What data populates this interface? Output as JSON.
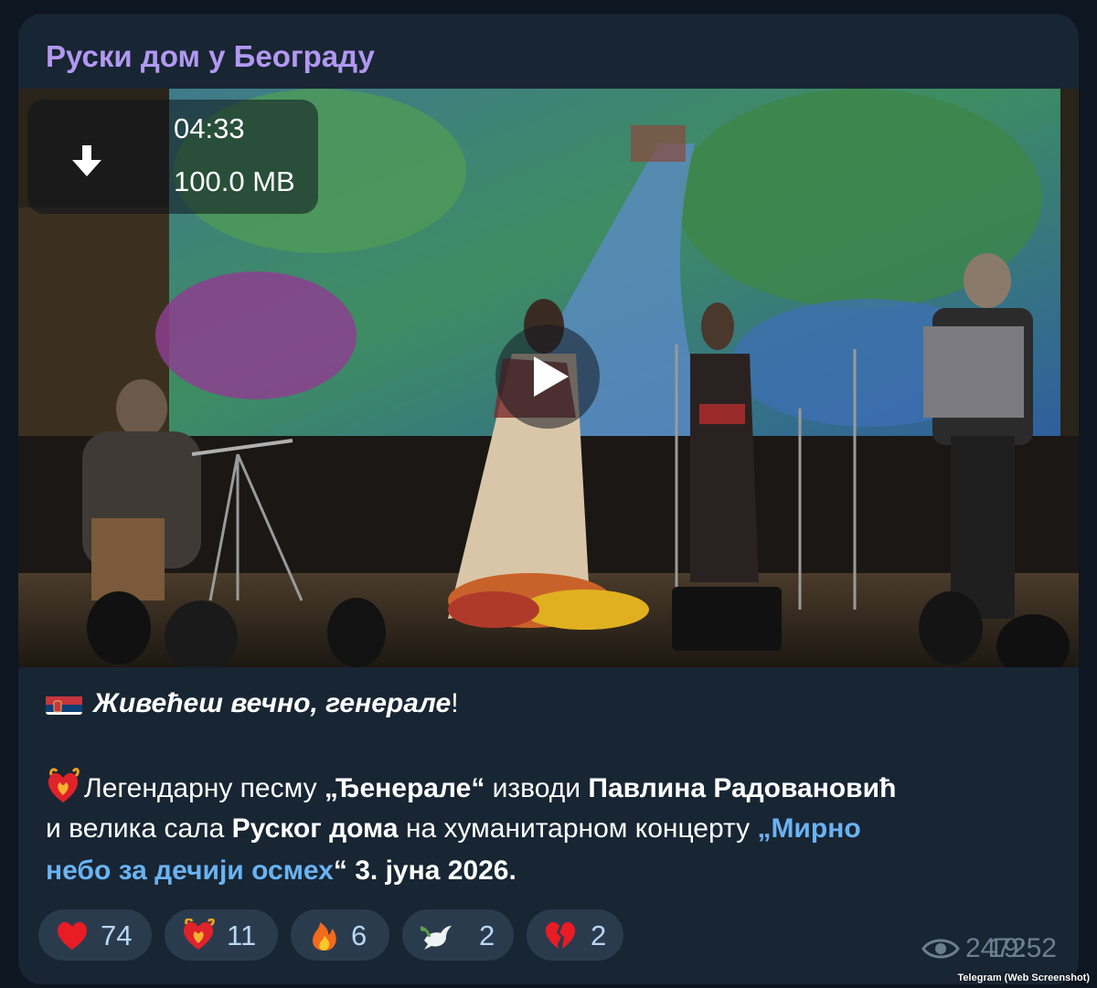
{
  "channel": {
    "name": "Руски дом у Београду"
  },
  "video": {
    "duration": "04:33",
    "size": "100.0 MB"
  },
  "caption": {
    "headline": "Живећеш вечно, генерале",
    "headline_end": "!",
    "p1_a": "Легендарну песму ",
    "p1_song": "„Ђенерале“",
    "p1_b": " изводи ",
    "p1_performer": "Павлина Радовановић",
    "p2_a": "и велика сала ",
    "p2_hall": "Руског дома",
    "p2_b": " на хуманитарном концерту ",
    "p2_link1": "„Мирно",
    "p3_link2": "небо за дечији осмех",
    "p3_close": "“",
    "p3_date": " 3. јуна 2026."
  },
  "reactions": [
    {
      "emoji": "red-heart-icon",
      "count": "74"
    },
    {
      "emoji": "heart-on-fire-icon",
      "count": "11"
    },
    {
      "emoji": "fire-icon",
      "count": "6"
    },
    {
      "emoji": "dove-icon",
      "count": "2"
    },
    {
      "emoji": "broken-heart-icon",
      "count": "2"
    }
  ],
  "meta": {
    "views": "2472",
    "time": "19:52"
  },
  "watermark": "Telegram (Web Screenshot)",
  "colors": {
    "background": "#0e1621",
    "bubble": "#182533",
    "channel_name": "#b198f0",
    "link": "#6ab3f3",
    "reaction_bg": "#2b3b4e"
  }
}
